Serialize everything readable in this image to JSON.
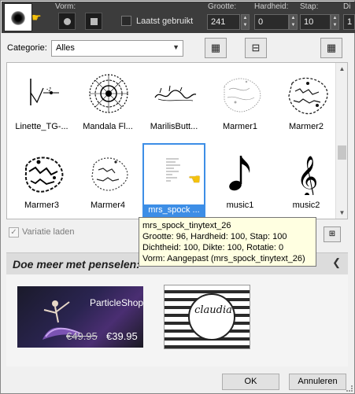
{
  "toolbar": {
    "shape_label": "Vorm:",
    "recent_label": "Laatst gebruikt",
    "params": [
      {
        "label": "Grootte:",
        "value": "241"
      },
      {
        "label": "Hardheid:",
        "value": "0"
      },
      {
        "label": "Stap:",
        "value": "10"
      },
      {
        "label": "Di",
        "value": "1"
      }
    ]
  },
  "category": {
    "label": "Categorie:",
    "selected": "Alles"
  },
  "brushes": [
    {
      "label": "Linette_TG-...",
      "icon": "brush-linette-icon"
    },
    {
      "label": "Mandala Fl...",
      "icon": "brush-mandala-icon"
    },
    {
      "label": "MarilisButt...",
      "icon": "brush-marilis-icon"
    },
    {
      "label": "Marmer1",
      "icon": "brush-marmer1-icon"
    },
    {
      "label": "Marmer2",
      "icon": "brush-marmer2-icon"
    },
    {
      "label": "Marmer3",
      "icon": "brush-marmer3-icon"
    },
    {
      "label": "Marmer4",
      "icon": "brush-marmer4-icon"
    },
    {
      "label": "mrs_spock ...",
      "icon": "brush-tinytext-icon",
      "selected": true
    },
    {
      "label": "music1",
      "icon": "eighth-note-icon"
    },
    {
      "label": "music2",
      "icon": "treble-clef-icon"
    }
  ],
  "variation": {
    "label": "Variatie laden",
    "checked": true
  },
  "tooltip": {
    "lines": [
      "mrs_spock_tinytext_26",
      "Grootte: 96, Hardheid: 100, Stap: 100",
      "Dichtheid: 100, Dikte: 100, Rotatie: 0",
      "Vorm: Aangepast (mrs_spock_tinytext_26)"
    ]
  },
  "more_section": {
    "title": "Doe meer met penselen:",
    "promo1": {
      "name": "ParticleShop",
      "old_price": "€49.95",
      "new_price": "€39.95"
    },
    "promo2": {
      "logo_text": "claudia"
    }
  },
  "footer": {
    "ok_label": "OK",
    "cancel_label": "Annuleren"
  }
}
